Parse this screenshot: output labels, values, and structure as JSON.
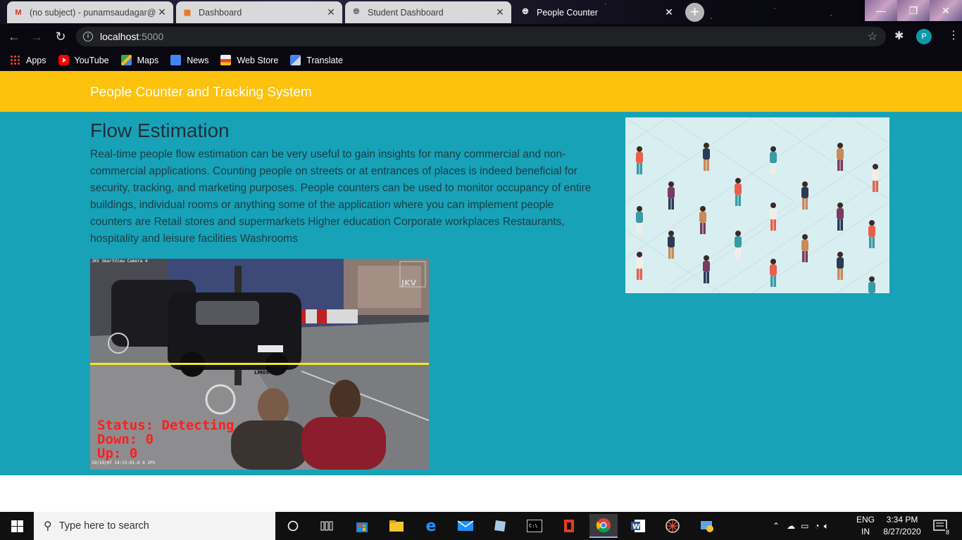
{
  "browser": {
    "tabs": [
      {
        "label": "(no subject) - punamsaudagar@",
        "favicon": "gmail-icon",
        "active": false
      },
      {
        "label": "Dashboard",
        "favicon": "dashboard-icon",
        "active": false
      },
      {
        "label": "Student Dashboard",
        "favicon": "globe-icon",
        "active": false
      },
      {
        "label": "People Counter",
        "favicon": "globe-icon",
        "active": true
      }
    ],
    "new_tab_label": "+",
    "url_host": "localhost",
    "url_port": ":5000",
    "profile_initial": "P",
    "bookmarks": [
      {
        "label": "Apps",
        "icon": "apps-grid-icon"
      },
      {
        "label": "YouTube",
        "icon": "youtube-icon"
      },
      {
        "label": "Maps",
        "icon": "maps-icon"
      },
      {
        "label": "News",
        "icon": "news-icon"
      },
      {
        "label": "Web Store",
        "icon": "web-store-icon"
      },
      {
        "label": "Translate",
        "icon": "translate-icon"
      }
    ]
  },
  "page": {
    "brand": "People Counter and Tracking System",
    "heading": "Flow Estimation",
    "description": "Real-time people flow estimation can be very useful to gain insights for many commercial and non-commercial applications. Counting people on streets or at entrances of places is indeed beneficial for security, tracking, and marketing purposes. People counters can be used to monitor occupancy of entire buildings, individual rooms or anything some of the application where you can implement people counters are Retail stores and supermarkets Higher education Corporate workplaces Restaurants, hospitality and leisure facilities Washrooms",
    "video": {
      "camera_label": "JKV SmartView Camera 4",
      "watermark": "JKV",
      "plate": "LM05 YHA",
      "status": "Status: Detecting",
      "down": "Down: 0",
      "up": "Up: 0",
      "timestamp": "19/10/07 14:53:01.6 6 IPS"
    }
  },
  "taskbar": {
    "search_placeholder": "Type here to search",
    "lang_top": "ENG",
    "lang_bottom": "IN",
    "time": "3:34 PM",
    "date": "8/27/2020",
    "notifications": "8"
  },
  "colors": {
    "header_bg": "#fdc20e",
    "main_bg": "#17a2b8",
    "count_line": "#f2ea1c",
    "overlay_text": "#ff1e1e"
  }
}
